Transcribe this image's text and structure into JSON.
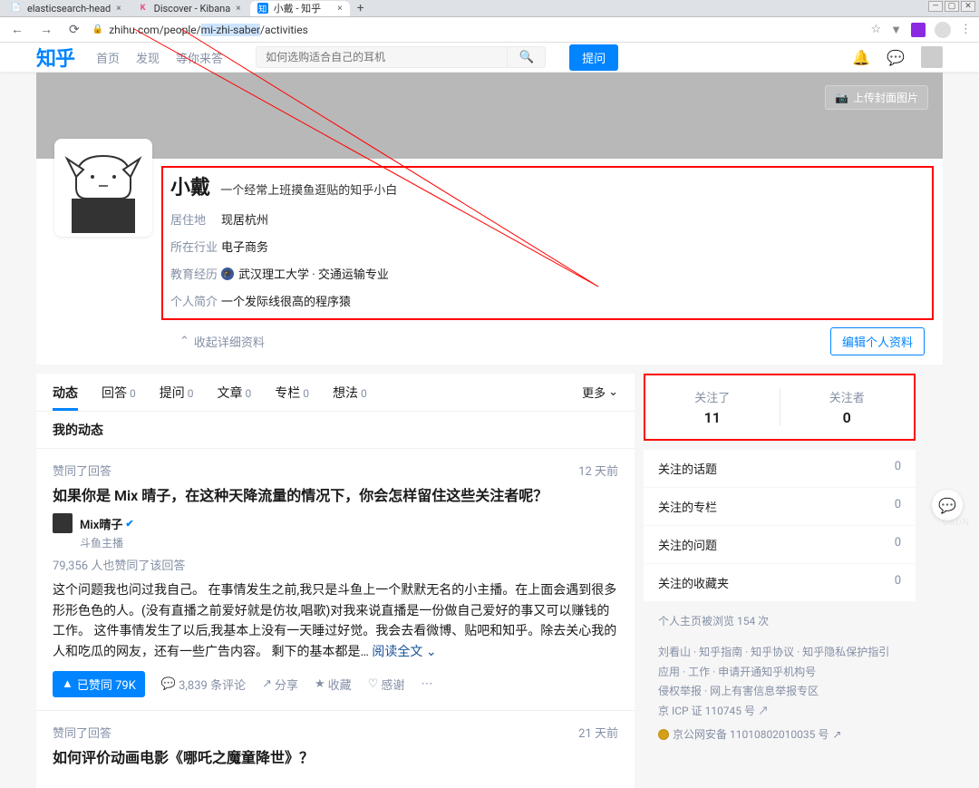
{
  "browser": {
    "tabs": [
      {
        "icon": "📄",
        "title": "elasticsearch-head"
      },
      {
        "icon": "K",
        "title": "Discover - Kibana"
      },
      {
        "icon": "知",
        "title": "小戴 - 知乎"
      }
    ],
    "url_prefix": "zhihu.com/people/",
    "url_highlight": "mi-zhi-saber",
    "url_suffix": "/activities"
  },
  "header": {
    "logo": "知乎",
    "nav": [
      "首页",
      "发现",
      "等你来答"
    ],
    "search_placeholder": "如何选购适合自己的耳机",
    "ask_btn": "提问"
  },
  "banner": {
    "upload_btn": "上传封面图片"
  },
  "profile": {
    "name": "小戴",
    "tagline": "一个经常上班摸鱼逛贴的知乎小白",
    "rows": {
      "location": {
        "label": "居住地",
        "value": "现居杭州"
      },
      "industry": {
        "label": "所在行业",
        "value": "电子商务"
      },
      "education": {
        "label": "教育经历",
        "value": "武汉理工大学 · 交通运输专业"
      },
      "intro": {
        "label": "个人简介",
        "value": "一个发际线很高的程序猿"
      }
    },
    "collapse": "收起详细资料",
    "edit_btn": "编辑个人资料"
  },
  "tabs": {
    "dynamic": "动态",
    "answers": {
      "label": "回答",
      "count": "0"
    },
    "questions": {
      "label": "提问",
      "count": "0"
    },
    "articles": {
      "label": "文章",
      "count": "0"
    },
    "columns": {
      "label": "专栏",
      "count": "0"
    },
    "ideas": {
      "label": "想法",
      "count": "0"
    },
    "more": "更多"
  },
  "subtitle": "我的动态",
  "feed": [
    {
      "action": "赞同了回答",
      "time": "12 天前",
      "title": "如果你是 Mix 晴子，在这种天降流量的情况下，你会怎样留住这些关注者呢？",
      "author": "Mix晴子",
      "author_desc": "斗鱼主播",
      "vote_info": "79,356 人也赞同了该回答",
      "content": "这个问题我也问过我自己。 在事情发生之前,我只是斗鱼上一个默默无名的小主播。在上面会遇到很多形形色色的人。(没有直播之前爱好就是仿妆,唱歌)对我来说直播是一份做自己爱好的事又可以赚钱的工作。 这件事情发生了以后,我基本上没有一天睡过好觉。我会去看微博、贴吧和知乎。除去关心我的人和吃瓜的网友，还有一些广告内容。  剩下的基本都是…",
      "read_more": "阅读全文",
      "vote_btn": "已赞同 79K",
      "comments": "3,839 条评论",
      "share": "分享",
      "fav": "收藏",
      "thanks": "感谢"
    },
    {
      "action": "赞同了回答",
      "time": "21 天前",
      "title": "如何评价动画电影《哪吒之魔童降世》？"
    }
  ],
  "stats": {
    "following": {
      "label": "关注了",
      "value": "11"
    },
    "followers": {
      "label": "关注者",
      "value": "0"
    }
  },
  "side_rows": [
    {
      "label": "关注的话题",
      "value": "0"
    },
    {
      "label": "关注的专栏",
      "value": "0"
    },
    {
      "label": "关注的问题",
      "value": "0"
    },
    {
      "label": "关注的收藏夹",
      "value": "0"
    }
  ],
  "side_meta": "个人主页被浏览 154 次",
  "footer_links": {
    "line1": "刘看山 · 知乎指南 · 知乎协议 · 知乎隐私保护指引",
    "line2": "应用 · 工作 · 申请开通知乎机构号",
    "line3": "侵权举报 · 网上有害信息举报专区",
    "icp": "京 ICP 证 110745 号",
    "beian": "京公网安备 11010802010035 号"
  }
}
